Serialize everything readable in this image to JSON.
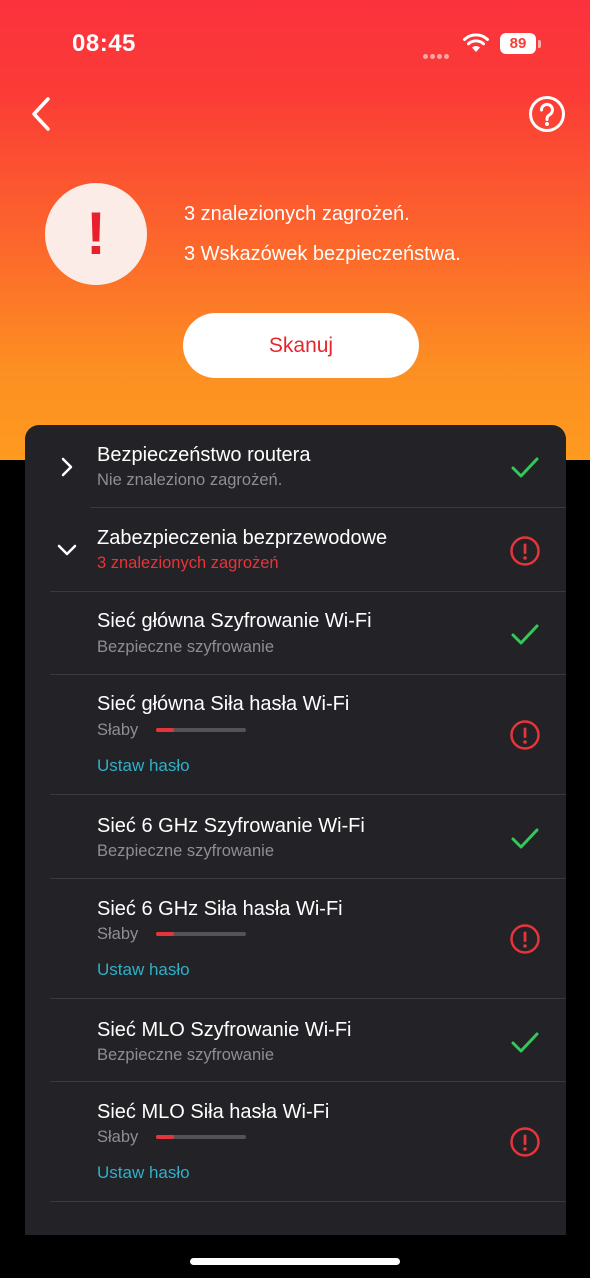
{
  "status_bar": {
    "time": "08:45",
    "battery": "89"
  },
  "header": {
    "summary_line1": "3 znalezionych zagrożeń.",
    "summary_line2": "3 Wskazówek bezpieczeństwa.",
    "scan_label": "Skanuj"
  },
  "colors": {
    "danger": "#E5353B",
    "ok": "#34C759",
    "link": "#2FB0C7"
  },
  "sections": [
    {
      "title": "Bezpieczeństwo routera",
      "subtitle": "Nie znaleziono zagrożeń.",
      "expanded": false,
      "status": "ok"
    },
    {
      "title": "Zabezpieczenia bezprzewodowe",
      "subtitle": "3 znalezionych zagrożeń",
      "expanded": true,
      "status": "warning"
    }
  ],
  "items": [
    {
      "title": "Sieć główna Szyfrowanie Wi-Fi",
      "subtitle": "Bezpieczne szyfrowanie",
      "status": "ok"
    },
    {
      "title": "Sieć główna Siła hasła Wi-Fi",
      "subtitle": "Słaby",
      "strength": 0.2,
      "action": "Ustaw hasło",
      "status": "warning"
    },
    {
      "title": "Sieć 6 GHz Szyfrowanie Wi-Fi",
      "subtitle": "Bezpieczne szyfrowanie",
      "status": "ok"
    },
    {
      "title": "Sieć 6 GHz Siła hasła Wi-Fi",
      "subtitle": "Słaby",
      "strength": 0.2,
      "action": "Ustaw hasło",
      "status": "warning"
    },
    {
      "title": "Sieć MLO Szyfrowanie Wi-Fi",
      "subtitle": "Bezpieczne szyfrowanie",
      "status": "ok"
    },
    {
      "title": "Sieć MLO Siła hasła Wi-Fi",
      "subtitle": "Słaby",
      "strength": 0.2,
      "action": "Ustaw hasło",
      "status": "warning"
    }
  ]
}
